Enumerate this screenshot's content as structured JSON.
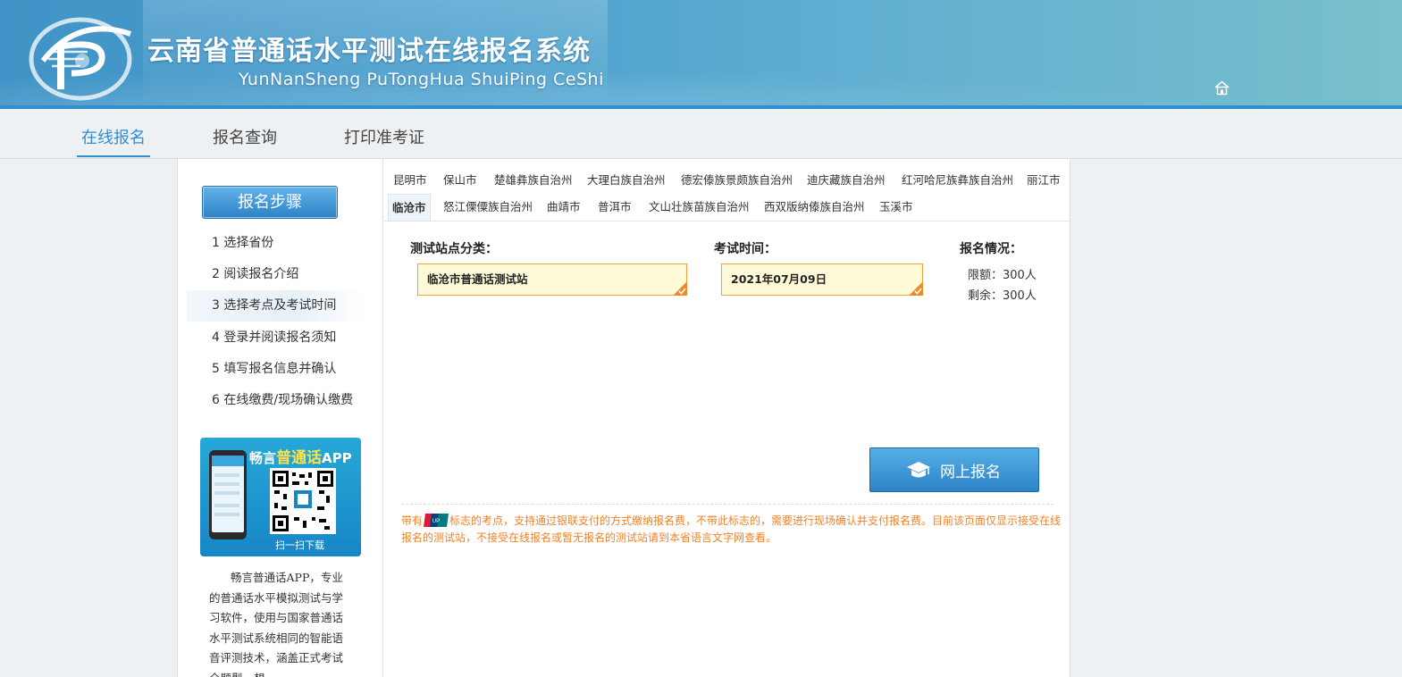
{
  "header": {
    "title": "云南省普通话水平测试在线报名系统",
    "subtitle": "YunNanSheng PuTongHua ShuiPing CeShi",
    "home_icon": "home-icon"
  },
  "nav": {
    "items": [
      {
        "label": "在线报名",
        "active": true
      },
      {
        "label": "报名查询",
        "active": false
      },
      {
        "label": "打印准考证",
        "active": false
      }
    ]
  },
  "sidebar": {
    "steps_title": "报名步骤",
    "steps": [
      {
        "label": "1 选择省份"
      },
      {
        "label": "2 阅读报名介绍"
      },
      {
        "label": "3 选择考点及考试时间",
        "active": true
      },
      {
        "label": "4 登录并阅读报名须知"
      },
      {
        "label": "5 填写报名信息并确认"
      },
      {
        "label": "6 在线缴费/现场确认缴费"
      }
    ],
    "app": {
      "title_prefix": "畅言",
      "title_highlight": "普通话",
      "title_suffix": "APP",
      "scan": "扫一扫下载",
      "description": "畅言普通话APP，专业的普通话水平模拟测试与学习软件，使用与国家普通话水平测试系统相同的智能语音评测技术，涵盖正式考试全题型，想"
    }
  },
  "tabs": {
    "row1": [
      "昆明市",
      "保山市",
      "楚雄彝族自治州",
      "大理白族自治州",
      "德宏傣族景颇族自治州",
      "迪庆藏族自治州",
      "红河哈尼族彝族自治州",
      "丽江市"
    ],
    "row2": [
      "临沧市",
      "怒江傈僳族自治州",
      "曲靖市",
      "普洱市",
      "文山壮族苗族自治州",
      "西双版纳傣族自治州",
      "玉溪市"
    ],
    "active": "临沧市"
  },
  "form": {
    "site_label": "测试站点分类：",
    "site_value": "临沧市普通话测试站",
    "time_label": "考试时间：",
    "time_value": "2021年07月09日",
    "status_label": "报名情况：",
    "limit": "限额：300人",
    "remaining": "剩余：300人",
    "submit_label": "网上报名"
  },
  "notice": {
    "before": "带有",
    "after": "标志的考点，支持通过银联支付的方式缴纳报名费，不带此标志的，需要进行现场确认并支付报名费。目前该页面仅显示接受在线报名的测试站，不接受在线报名或暂无报名的测试站请到本省语言文字网查看。"
  },
  "colors": {
    "accent": "#2f8fd0",
    "notice": "#f08228",
    "select_border": "#f0a13a",
    "select_bg": "#fffbd9"
  }
}
